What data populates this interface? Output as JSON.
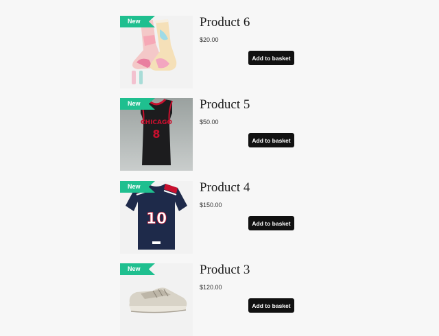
{
  "products": [
    {
      "badge": "New",
      "title": "Product 6",
      "price": "$20.00",
      "button": "Add to basket",
      "image": "tie-dye-socks"
    },
    {
      "badge": "New",
      "title": "Product 5",
      "price": "$50.00",
      "button": "Add to basket",
      "image": "chicago-jersey"
    },
    {
      "badge": "New",
      "title": "Product 4",
      "price": "$150.00",
      "button": "Add to basket",
      "image": "patriots-jersey"
    },
    {
      "badge": "New",
      "title": "Product 3",
      "price": "$120.00",
      "button": "Add to basket",
      "image": "sneaker"
    }
  ],
  "colors": {
    "badge": "#1fbf8f",
    "button": "#111111",
    "background": "#f7f7f7"
  }
}
